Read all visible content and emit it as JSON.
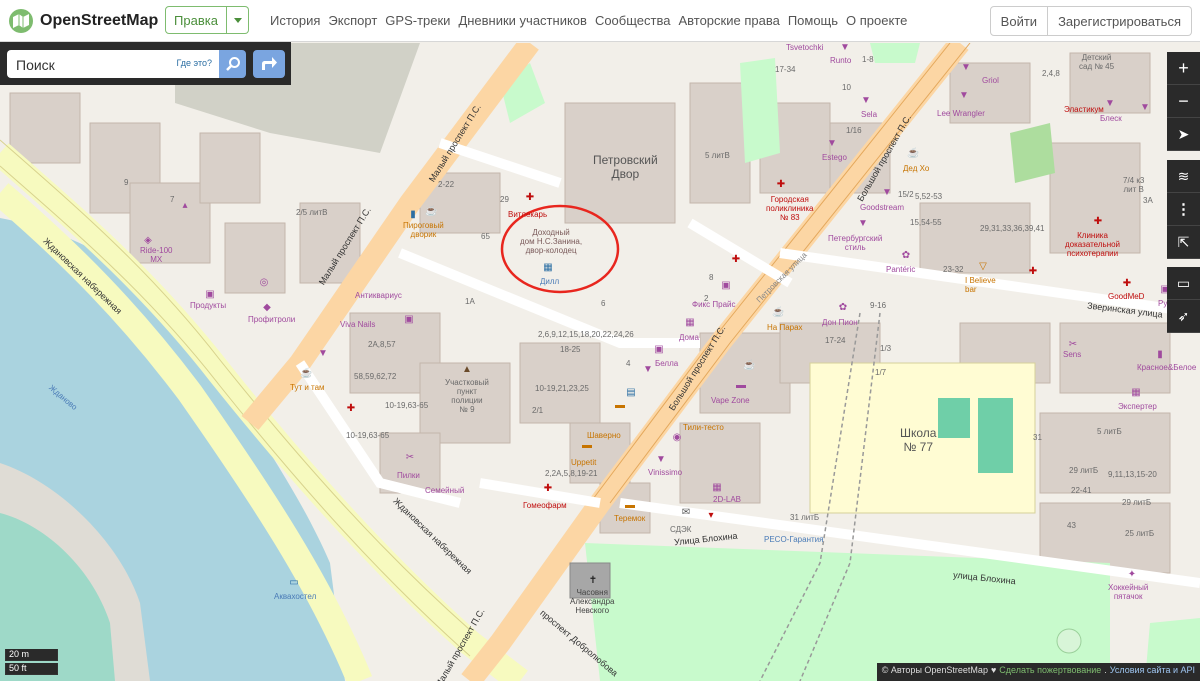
{
  "header": {
    "brand": "OpenStreetMap",
    "edit_label": "Правка",
    "nav": [
      "История",
      "Экспорт",
      "GPS-треки",
      "Дневники участников",
      "Сообщества",
      "Авторские права",
      "Помощь",
      "О проекте"
    ],
    "login": "Войти",
    "signup": "Зарегистрироваться"
  },
  "search": {
    "placeholder": "Поиск",
    "where_is": "Где это?"
  },
  "map": {
    "labels": {
      "petrovsky": "Петровский\nДвор",
      "dohodny": "Доходный\nдом Н.С.Занина,\nдвор-колодец",
      "dill": "Дилл",
      "vitlekar": "Витлекарь",
      "pirogovy": "Пироговый\nдворик",
      "ride": "Ride-100\nMX",
      "produkty": "Продукты",
      "profitroli": "Профитроли",
      "antikvarius": "Антиквариус",
      "viva": "Viva Nails",
      "tut": "Тут и там",
      "uchastkovy": "Участковый\nпункт\nполиции\n№ 9",
      "pilki": "Пилки",
      "semeyny": "Семейный",
      "gomeofarm": "Гомеофарм",
      "shaverno": "Шаверно",
      "uppetit": "Uppetit",
      "bella": "Белла",
      "doma": "Дома",
      "fix": "Фикс Прайс",
      "naparah": "На Парах",
      "donpion": "Дон Пион",
      "vape": "Vape Zone",
      "tili": "Тили-тесто",
      "vinissimo": "Vinissimo",
      "lab": "2D-LAB",
      "teremok": "Теремок",
      "sdek": "СДЭК",
      "peso": "PECO-Гарантия",
      "school": "Школа\n№ 77",
      "chasovnya": "Часовня\nАлександра\nНевского",
      "akvahostel": "Аквахостел",
      "goodstream": "Goodstream",
      "poliklinika": "Городская\nполиклиника\n№ 83",
      "peterburg": "Петербургский\nстиль",
      "panteric": "Pantéric",
      "ibelieve": "I Believe\nbar",
      "klinika": "Клиника\nдоказательной\nпсихотерапии",
      "goodmed": "GoodMeD",
      "sens": "Sens",
      "krasnoe": "Красное&Белое",
      "ekspert": "Экспертер",
      "hokkey": "Хоккейный\nпятачок",
      "elastikum": "Эластикум",
      "blesk": "Блеск",
      "detsad": "Детский\nсад № 45",
      "griol": "Griol",
      "leewrangler": "Lee Wrangler",
      "runto": "Runto",
      "sela": "Sela",
      "estego": "Estego",
      "dedho": "Дед Хо",
      "tsvetochki": "Tsvetochki",
      "rumola": "Румола",
      "zhdanovo": "Жданово"
    },
    "roads": {
      "maly": "Малый проспект П.С.",
      "maly2": "Малый проспект П.С.",
      "bolshoy": "Большой проспект П.С.",
      "bolshoy2": "Большой проспект П.С.",
      "zhdanovskaya": "Ждановская набережная",
      "zhdanovskaya2": "Ждановская набережная",
      "blohina": "Улица Блохина",
      "blohina2": "улица Блохина",
      "zverinskaya": "Зверинская улица",
      "dobrolyubova": "проспект Добролюбова",
      "maly3": "Малый проспект П.С.",
      "petrovsky_st": "Петровская улица"
    },
    "numbers": {
      "n1": "1А",
      "n2": "65",
      "n3": "29",
      "n4": "2-22",
      "n5": "6",
      "n6": "4",
      "n7": "2,6,9,12,15,18,20,22,24,26",
      "n8": "18-25",
      "n9": "10-19,21,23,25",
      "n10": "2/1",
      "n11": "2,2А,5,8,19-21",
      "n12": "58,59,62,72",
      "n13": "10-19,63-65",
      "n14": "10-19,63-65",
      "n15": "2А,8,57",
      "n16": "9",
      "n17": "7",
      "n18": "2/5 литВ",
      "n19": "5 литВ",
      "n20": "17-34",
      "n21": "10",
      "n22": "1-8",
      "n23": "1/16",
      "n24": "15/2",
      "n25": "5,52-53",
      "n26": "15,54-55",
      "n27": "29,31,33,36,39,41",
      "n28": "23-32",
      "n29": "9-16",
      "n30": "17-24",
      "n31": "1/3",
      "n32": "1/7",
      "n33": "31 литБ",
      "n34": "31",
      "n35": "5 литБ",
      "n36": "29 литБ",
      "n37": "9,11,13,15-20",
      "n38": "22-41",
      "n39": "29 литБ",
      "n40": "43",
      "n41": "25 литБ",
      "n42": "7/4 к3\nлит В",
      "n43": "3А",
      "n44": "2,4,8",
      "n45": "2",
      "n46": "8"
    }
  },
  "controls": {
    "zoom_in": "+",
    "zoom_out": "−"
  },
  "scale": {
    "metric": "20 m",
    "imperial": "50 ft"
  },
  "attribution": {
    "authors": "© Авторы OpenStreetMap",
    "donate": "Сделать пожертвование",
    "terms": "Условия сайта и API"
  },
  "colors": {
    "primary_road": "#fcd6a4",
    "secondary_road": "#f7fabf",
    "water": "#aad3df",
    "building": "#d9d0c9",
    "park": "#c8facc",
    "school": "#fffcd3",
    "accent_green": "#7ebc6f",
    "accent_blue": "#7aa5e0",
    "circle_annotation": "#e8261e"
  }
}
